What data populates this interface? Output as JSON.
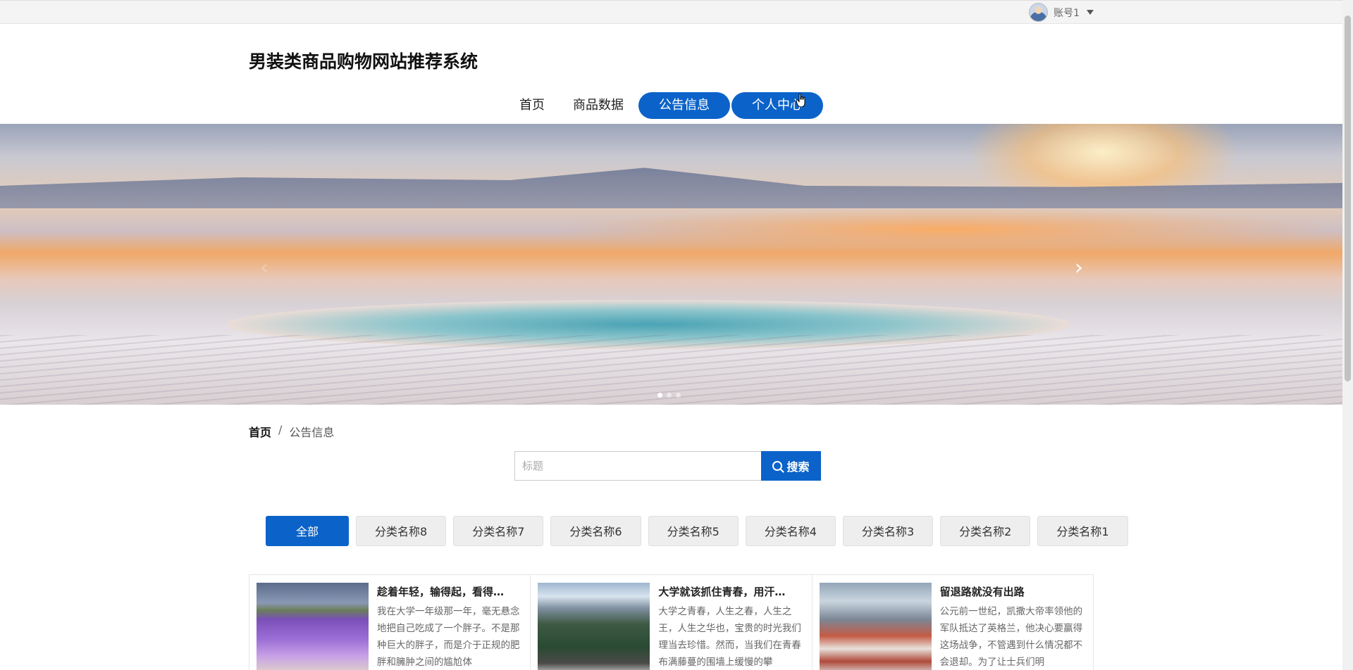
{
  "header": {
    "account_label": "账号1",
    "site_title": "男装类商品购物网站推荐系统"
  },
  "nav": {
    "items": [
      "首页",
      "商品数据",
      "公告信息",
      "个人中心"
    ],
    "active": "公告信息"
  },
  "banner": {
    "prev_icon": "chevron-left-icon",
    "next_icon": "chevron-right-icon",
    "slide_count": 3,
    "active_slide": 1
  },
  "breadcrumb": {
    "home": "首页",
    "separator": "/",
    "current": "公告信息"
  },
  "search": {
    "placeholder": "标题",
    "value": "",
    "button_label": "搜索"
  },
  "categories": {
    "items": [
      "全部",
      "分类名称8",
      "分类名称7",
      "分类名称6",
      "分类名称5",
      "分类名称4",
      "分类名称3",
      "分类名称2",
      "分类名称1"
    ],
    "active": "全部"
  },
  "cards": [
    {
      "title": "趁着年轻，输得起，看得…",
      "text": "我在大学一年级那一年，毫无悬念地把自己吃成了一个胖子。不是那种巨大的胖子，而是介于正规的肥胖和臃肿之间的尴尬体"
    },
    {
      "title": "大学就该抓住青春，用汗…",
      "text": "大学之青春，人生之春，人生之王，人生之华也，宝贵的时光我们理当去珍惜。然而，当我们在青春布满藤蔓的围墙上缓慢的攀"
    },
    {
      "title": "留退路就没有出路",
      "text": "公元前一世纪，凯撒大帝率领他的军队抵达了英格兰，他决心要赢得这场战争，不管遇到什么情况都不会退却。为了让士兵们明"
    }
  ],
  "colors": {
    "accent": "#0b63c9"
  }
}
